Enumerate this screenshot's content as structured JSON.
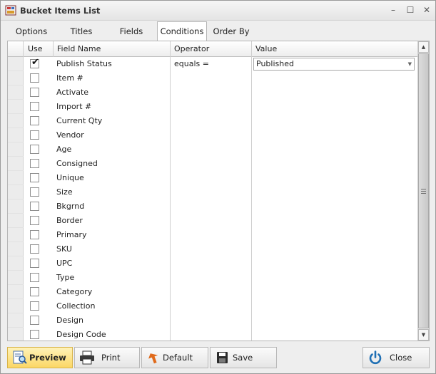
{
  "window": {
    "title": "Bucket Items List",
    "minimize": "–",
    "maximize": "☐",
    "close": "✕"
  },
  "tabs": [
    {
      "label": "Options",
      "active": false
    },
    {
      "label": "Titles",
      "active": false
    },
    {
      "label": "Fields",
      "active": false
    },
    {
      "label": "Conditions",
      "active": true
    },
    {
      "label": "Order By",
      "active": false
    }
  ],
  "grid": {
    "columns": {
      "use": "Use",
      "field_name": "Field Name",
      "operator": "Operator",
      "value": "Value"
    },
    "rows": [
      {
        "field": "Publish Status",
        "checked": true,
        "operator": "equals =",
        "value": "Published"
      },
      {
        "field": "Item #",
        "checked": false
      },
      {
        "field": "Activate",
        "checked": false
      },
      {
        "field": "Import #",
        "checked": false
      },
      {
        "field": "Current Qty",
        "checked": false
      },
      {
        "field": "Vendor",
        "checked": false
      },
      {
        "field": "Age",
        "checked": false
      },
      {
        "field": "Consigned",
        "checked": false
      },
      {
        "field": "Unique",
        "checked": false
      },
      {
        "field": "Size",
        "checked": false
      },
      {
        "field": "Bkgrnd",
        "checked": false
      },
      {
        "field": "Border",
        "checked": false
      },
      {
        "field": "Primary",
        "checked": false
      },
      {
        "field": "SKU",
        "checked": false
      },
      {
        "field": "UPC",
        "checked": false
      },
      {
        "field": "Type",
        "checked": false
      },
      {
        "field": "Category",
        "checked": false
      },
      {
        "field": "Collection",
        "checked": false
      },
      {
        "field": "Design",
        "checked": false
      },
      {
        "field": "Design Code",
        "checked": false
      }
    ]
  },
  "buttons": {
    "preview": "Preview",
    "print": "Print",
    "default": "Default",
    "save": "Save",
    "close": "Close"
  },
  "colors": {
    "accent_yellow": "#fbd765",
    "power_blue": "#1f6fb4",
    "default_orange": "#e06a1b"
  }
}
